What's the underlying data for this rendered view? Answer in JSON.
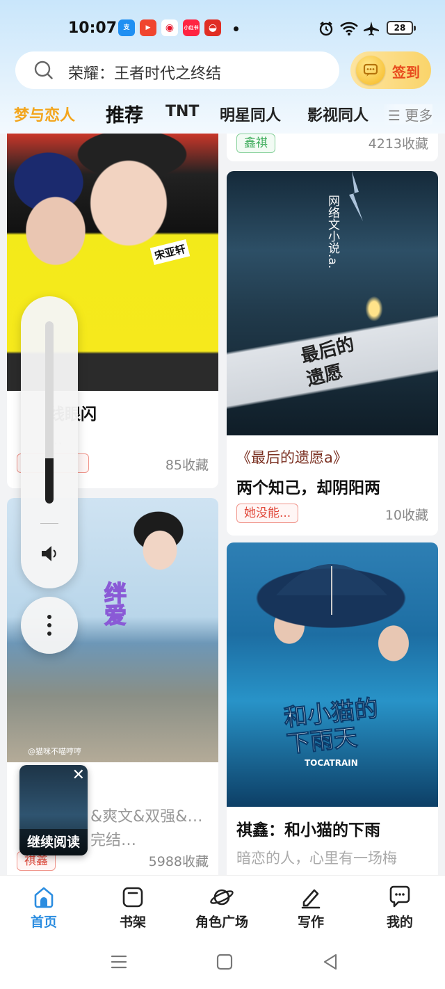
{
  "status_bar": {
    "time": "10:07",
    "notification_apps": [
      "alipay-icon",
      "video-icon",
      "weibo-icon",
      "xiaohongshu-icon",
      "pinduoduo-icon"
    ],
    "xiaohongshu_label": "小红书",
    "battery": "28"
  },
  "search": {
    "text": "荣耀：王者时代之终结"
  },
  "checkin": {
    "label": "签到"
  },
  "tabs": [
    {
      "label": "梦与恋人"
    },
    {
      "label": "推荐"
    },
    {
      "label": "TNT"
    },
    {
      "label": "明星同人"
    },
    {
      "label": "影视同人"
    }
  ],
  "tabs_more": "☰ 更多",
  "feed": {
    "left": [
      {
        "title": "线眼闪",
        "desc": "…",
        "tag": "",
        "favorites": "85收藏",
        "cover_badge": "宋亚轩"
      },
      {
        "overlay": "绊爱",
        "watermark": "@猫咪不喵哼哼",
        "title": "&爽文&双强&HE|",
        "desc": "完结…",
        "tag": "祺鑫",
        "favorites": "5988收藏"
      }
    ],
    "right": [
      {
        "tag": "鑫祺",
        "favorites": "4213收藏"
      },
      {
        "cover_caption": "网络文小说.a.",
        "cover_paper": "最后的遗愿",
        "subtitle": "《最后的遗愿a》",
        "title": "两个知己，却阴阳两",
        "tag": "她没能...",
        "favorites": "10收藏"
      },
      {
        "cover_title": "和小猫的下雨天",
        "cover_subtitle": "TOCATRAIN",
        "title": "祺鑫：和小猫的下雨",
        "desc": "暗恋的人，心里有一场梅"
      }
    ]
  },
  "continue_reading": {
    "label": "继续阅读",
    "close": "✕"
  },
  "bottom_nav": [
    {
      "label": "首页",
      "icon": "home-icon",
      "active": true
    },
    {
      "label": "书架",
      "icon": "bookshelf-icon"
    },
    {
      "label": "角色广场",
      "icon": "planet-icon"
    },
    {
      "label": "写作",
      "icon": "pen-icon"
    },
    {
      "label": "我的",
      "icon": "chat-bubble-icon"
    }
  ],
  "volume": {
    "level": 0.25
  },
  "colors": {
    "accent": "#f3a51c",
    "nav_active": "#2b8de0",
    "tag_green": "#3aaa58",
    "tag_red": "#e0483a",
    "checkin_text": "#e84a1d"
  }
}
